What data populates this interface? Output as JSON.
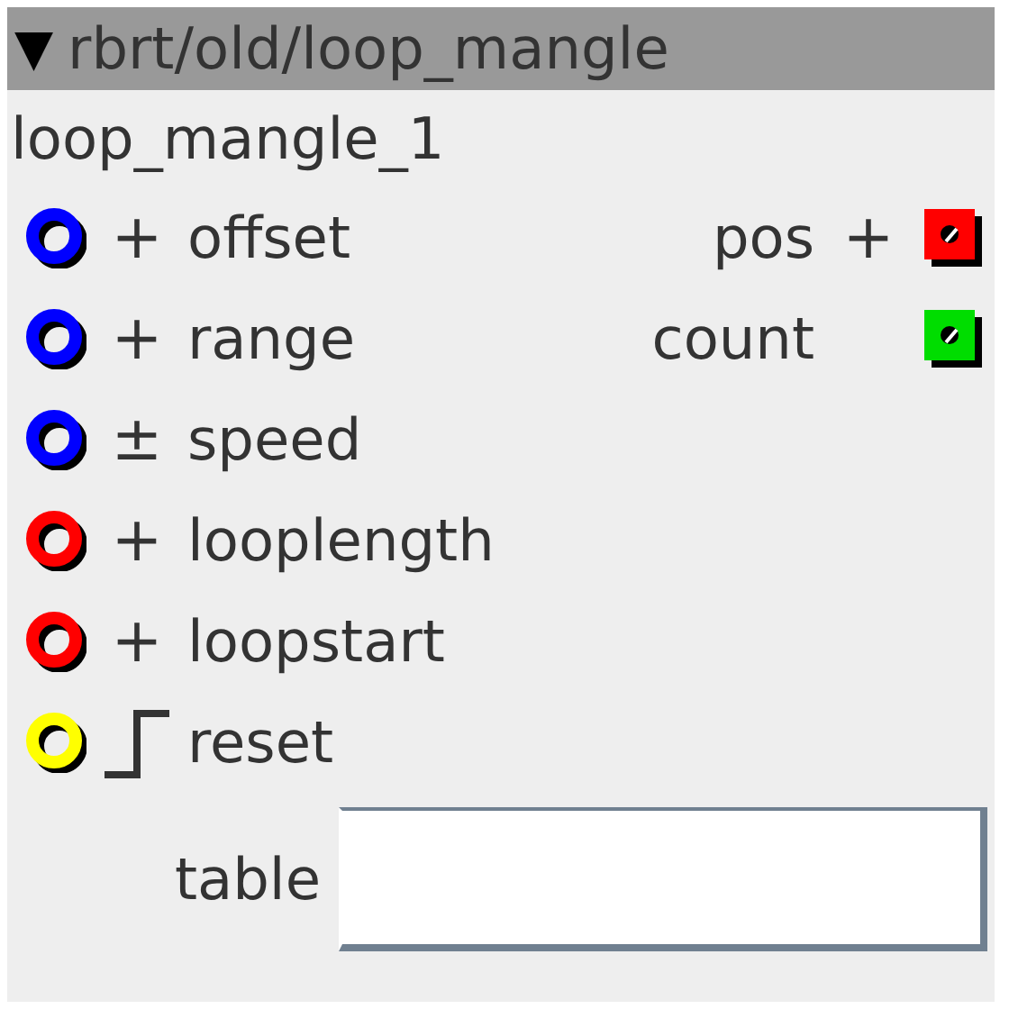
{
  "header": {
    "arrow": "▼",
    "title": "rbrt/old/loop_mangle"
  },
  "node_name": "loop_mangle_1",
  "inputs": [
    {
      "label": "offset",
      "color": "#0000ff",
      "kind": "value",
      "symbol": "+"
    },
    {
      "label": "range",
      "color": "#0000ff",
      "kind": "value",
      "symbol": "+"
    },
    {
      "label": "speed",
      "color": "#0000ff",
      "kind": "value",
      "symbol": "±"
    },
    {
      "label": "looplength",
      "color": "#ff0000",
      "kind": "value",
      "symbol": "+"
    },
    {
      "label": "loopstart",
      "color": "#ff0000",
      "kind": "value",
      "symbol": "+"
    },
    {
      "label": "reset",
      "color": "#ffff00",
      "kind": "trigger"
    }
  ],
  "outputs": [
    {
      "label": "pos",
      "color": "#ff0000",
      "symbol": "+"
    },
    {
      "label": "count",
      "color": "#00dd00"
    }
  ],
  "table": {
    "label": "table"
  }
}
